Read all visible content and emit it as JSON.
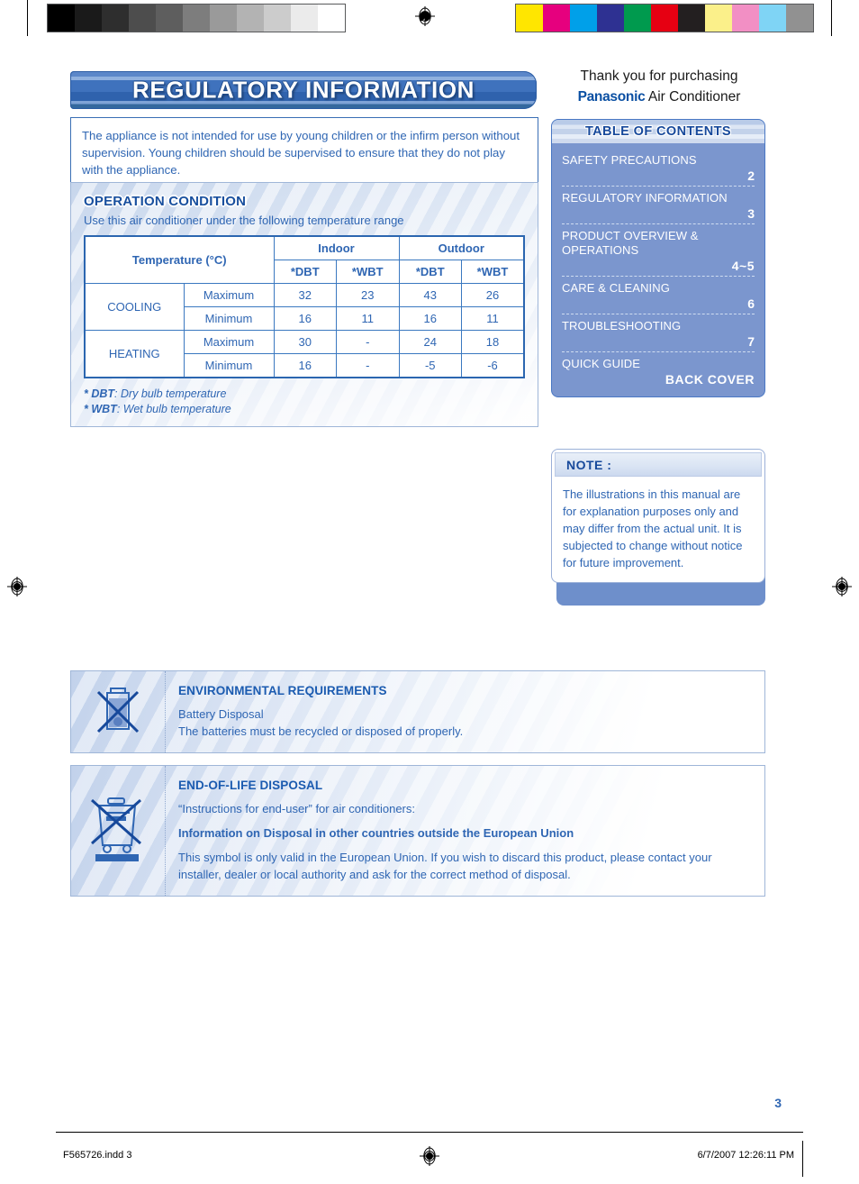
{
  "calibration": {
    "gray_ramp": [
      "#000000",
      "#1a1a1a",
      "#2e2e2e",
      "#4d4d4d",
      "#5e5e5e",
      "#7d7d7d",
      "#9a9a9a",
      "#b3b3b3",
      "#cccccc",
      "#ebebeb",
      "#ffffff"
    ],
    "color_ramp": [
      "#ffe600",
      "#e6007e",
      "#00a0e9",
      "#2e3192",
      "#009a4e",
      "#e60012",
      "#231f20",
      "#fbf08a",
      "#f28fc4",
      "#7fd4f5",
      "#919191"
    ],
    "registration_mark": "registration-target-mark"
  },
  "header": {
    "banner_title": "REGULATORY INFORMATION",
    "warning_text": "The appliance is not intended for use by young children or the infirm person without supervision. Young children should be supervised to ensure that they do not play with the appliance."
  },
  "thanks": {
    "line1": "Thank you for purchasing",
    "brand": "Panasonic",
    "product": " Air Conditioner"
  },
  "operation_condition": {
    "title": "OPERATION CONDITION",
    "subtitle": "Use this air conditioner under the following temperature range",
    "table": {
      "corner_label": "Temperature (°C)",
      "group_headers": [
        "Indoor",
        "Outdoor"
      ],
      "sub_headers": [
        "*DBT",
        "*WBT",
        "*DBT",
        "*WBT"
      ],
      "rows": [
        {
          "mode": "COOLING",
          "limit": "Maximum",
          "values": [
            "32",
            "23",
            "43",
            "26"
          ]
        },
        {
          "mode": "COOLING",
          "limit": "Minimum",
          "values": [
            "16",
            "11",
            "16",
            "11"
          ]
        },
        {
          "mode": "HEATING",
          "limit": "Maximum",
          "values": [
            "30",
            "-",
            "24",
            "18"
          ]
        },
        {
          "mode": "HEATING",
          "limit": "Minimum",
          "values": [
            "16",
            "-",
            "-5",
            "-6"
          ]
        }
      ]
    },
    "footnotes": [
      {
        "abbr": "* DBT",
        "desc": ":  Dry bulb temperature"
      },
      {
        "abbr": "* WBT",
        "desc": ":  Wet bulb temperature"
      }
    ]
  },
  "toc": {
    "heading": "TABLE OF CONTENTS",
    "items": [
      {
        "label": "SAFETY PRECAUTIONS",
        "page": "2"
      },
      {
        "label": "REGULATORY INFORMATION",
        "page": "3"
      },
      {
        "label": "PRODUCT OVERVIEW & OPERATIONS",
        "page": "4~5"
      },
      {
        "label": "CARE & CLEANING",
        "page": "6"
      },
      {
        "label": "TROUBLESHOOTING",
        "page": "7"
      },
      {
        "label": "QUICK GUIDE",
        "page": "BACK COVER"
      }
    ]
  },
  "note": {
    "heading": "NOTE :",
    "text": "The illustrations in this manual are for explanation purposes only and may differ from the actual unit. It is subjected to change without notice for future improvement."
  },
  "environmental": {
    "icon": "crossed-out-battery-icon",
    "title": "ENVIRONMENTAL REQUIREMENTS",
    "line1": "Battery Disposal",
    "line2": "The batteries must be recycled or disposed of properly."
  },
  "end_of_life": {
    "icon": "crossed-out-wheelie-bin-icon",
    "title": "END-OF-LIFE DISPOSAL",
    "line1": "“Instructions for end-user” for air conditioners:",
    "line2": "Information on Disposal in other countries outside the European Union",
    "line3": "This symbol is only valid in the European Union. If you wish to discard this product, please contact your installer, dealer or local authority and ask for the correct method of disposal."
  },
  "page_number": "3",
  "footer": {
    "file": "F565726.indd   3",
    "timestamp": "6/7/2007   12:26:11 PM"
  },
  "colors": {
    "brand_blue": "#0b50a3",
    "body_blue": "#2f66b3",
    "toc_blue": "#7b96ce",
    "banner_blue": "#2f62ad"
  }
}
